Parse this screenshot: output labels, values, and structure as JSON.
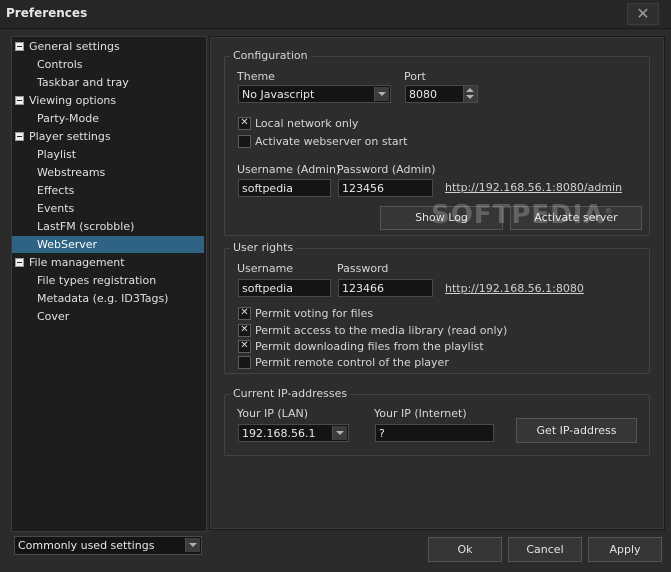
{
  "window": {
    "title": "Preferences",
    "close_glyph": "✕"
  },
  "tree": [
    {
      "label": "General settings",
      "level": 0
    },
    {
      "label": "Controls",
      "level": 1
    },
    {
      "label": "Taskbar and tray",
      "level": 1
    },
    {
      "label": "Viewing options",
      "level": 0
    },
    {
      "label": "Party-Mode",
      "level": 1
    },
    {
      "label": "Player settings",
      "level": 0
    },
    {
      "label": "Playlist",
      "level": 1
    },
    {
      "label": "Webstreams",
      "level": 1
    },
    {
      "label": "Effects",
      "level": 1
    },
    {
      "label": "Events",
      "level": 1
    },
    {
      "label": "LastFM (scrobble)",
      "level": 1
    },
    {
      "label": "WebServer",
      "level": 1,
      "selected": true
    },
    {
      "label": "File management",
      "level": 0
    },
    {
      "label": "File types registration",
      "level": 1
    },
    {
      "label": "Metadata (e.g. ID3Tags)",
      "level": 1
    },
    {
      "label": "Cover",
      "level": 1
    }
  ],
  "config": {
    "group_title": "Configuration",
    "theme_label": "Theme",
    "theme_value": "No Javascript",
    "port_label": "Port",
    "port_value": "8080",
    "local_only_label": "Local network only",
    "local_only_checked": true,
    "activate_on_start_label": "Activate webserver on start",
    "activate_on_start_checked": false,
    "admin_user_label": "Username (Admin)",
    "admin_user_value": "softpedia",
    "admin_pass_label": "Password (Admin)",
    "admin_pass_value": "123456",
    "admin_link": "http://192.168.56.1:8080/admin",
    "show_log_label": "Show Log",
    "activate_server_label": "Activate server"
  },
  "rights": {
    "group_title": "User rights",
    "user_label": "Username",
    "user_value": "softpedia",
    "pass_label": "Password",
    "pass_value": "123466",
    "link": "http://192.168.56.1:8080",
    "permissions": [
      {
        "label": "Permit voting for files",
        "checked": true
      },
      {
        "label": "Permit access to the media library (read only)",
        "checked": true
      },
      {
        "label": "Permit downloading files from the playlist",
        "checked": true
      },
      {
        "label": "Permit remote control of the player",
        "checked": false
      }
    ]
  },
  "ip": {
    "group_title": "Current IP-addresses",
    "lan_label": "Your IP (LAN)",
    "lan_value": "192.168.56.1",
    "internet_label": "Your IP (Internet)",
    "internet_value": "?",
    "get_ip_label": "Get IP-address"
  },
  "footer": {
    "settings_combo_value": "Commonly used settings",
    "ok_label": "Ok",
    "cancel_label": "Cancel",
    "apply_label": "Apply"
  },
  "watermark": {
    "text": "SOFTPEDIA",
    "mark": "®"
  },
  "colors": {
    "selection": "#2e6384",
    "background": "#2b2b2b",
    "field": "#141414"
  },
  "checkmark_glyph": "✕"
}
